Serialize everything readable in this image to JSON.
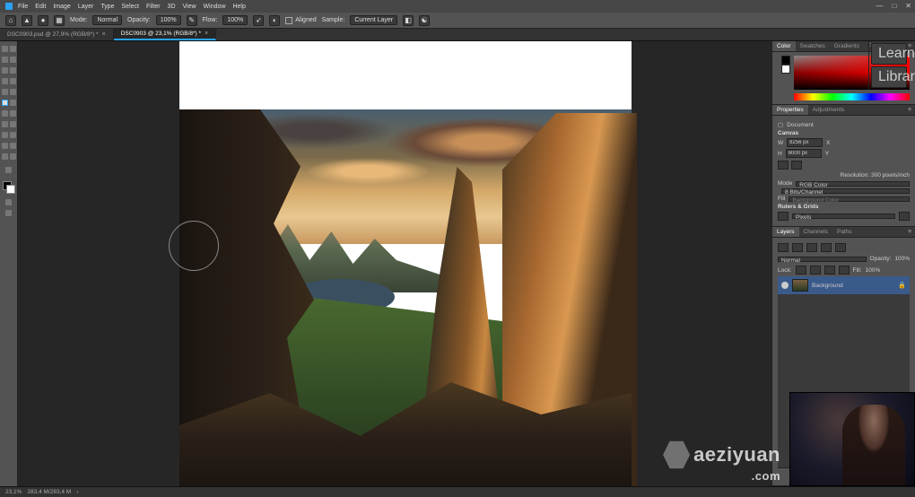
{
  "menu": {
    "items": [
      "File",
      "Edit",
      "Image",
      "Layer",
      "Type",
      "Select",
      "Filter",
      "3D",
      "View",
      "Window",
      "Help"
    ]
  },
  "options": {
    "mode_label": "Mode:",
    "mode": "Normal",
    "opacity_label": "Opacity:",
    "opacity": "100%",
    "flow_label": "Flow:",
    "flow": "100%",
    "aligned": "Aligned",
    "sample_label": "Sample:",
    "sample": "Current Layer"
  },
  "tabs": [
    {
      "label": "DSC0903.psd @ 27,9% (RGB/8*) *",
      "active": false
    },
    {
      "label": "DSC0903 @ 23,1% (RGB/8*) *",
      "active": true
    }
  ],
  "collapsed": [
    {
      "label": "Learn"
    },
    {
      "label": "Librari..."
    }
  ],
  "color_panel": {
    "tabs": [
      "Color",
      "Swatches",
      "Gradients",
      "Patterns"
    ]
  },
  "props_panel": {
    "tabs": [
      "Properties",
      "Adjustments"
    ],
    "doc_label": "Document",
    "canvas_label": "Canvas",
    "w_label": "W",
    "w_val": "8256 px",
    "x_label": "X",
    "h_label": "H",
    "h_val": "6000 px",
    "y_label": "Y",
    "resolution": "Resolution: 300 pixels/inch",
    "mode_label": "Mode",
    "mode_val": "RGB Color",
    "bits": "8 Bits/Channel",
    "fill_label": "Fill",
    "fill_hint": "Background Color",
    "rulers_label": "Rulers & Grids",
    "rulers_val": "Pixels"
  },
  "layers_panel": {
    "tabs": [
      "Layers",
      "Channels",
      "Paths"
    ],
    "blend": "Normal",
    "opacity_label": "Opacity:",
    "opacity": "100%",
    "lock_label": "Lock:",
    "fill_label": "Fill:",
    "fill": "100%",
    "layer_name": "Background"
  },
  "status": {
    "zoom": "23,1%",
    "doc": "283,4 M/283,4 M"
  },
  "watermark": {
    "text": "aeziyuan",
    "sub": ".com"
  }
}
